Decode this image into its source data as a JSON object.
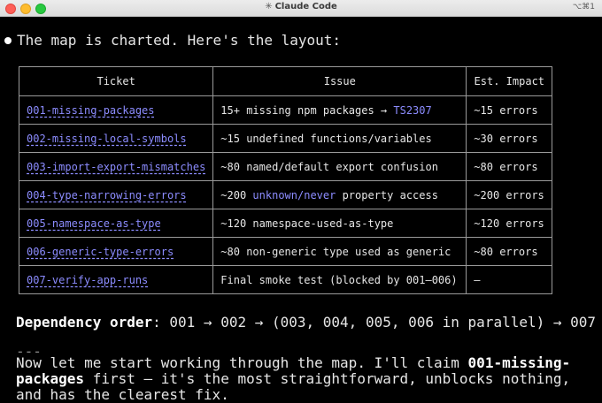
{
  "window": {
    "title": "Claude Code",
    "title_icon": "✳",
    "shortcut": "⌥⌘1"
  },
  "message": {
    "intro": "The map is charted. Here's the layout:"
  },
  "table": {
    "headers": [
      "Ticket",
      "Issue",
      "Est. Impact"
    ],
    "rows": [
      {
        "ticket": "001-missing-packages",
        "issue_pre": "15+ missing npm packages → ",
        "issue_hl": "TS2307",
        "issue_post": "",
        "impact": "~15 errors"
      },
      {
        "ticket": "002-missing-local-symbols",
        "issue_pre": "~15 undefined functions/variables",
        "issue_hl": "",
        "issue_post": "",
        "impact": "~30 errors"
      },
      {
        "ticket": "003-import-export-mismatches",
        "issue_pre": "~80 named/default export confusion",
        "issue_hl": "",
        "issue_post": "",
        "impact": "~80 errors"
      },
      {
        "ticket": "004-type-narrowing-errors",
        "issue_pre": "~200 ",
        "issue_hl": "unknown/never",
        "issue_post": " property access",
        "impact": "~200 errors"
      },
      {
        "ticket": "005-namespace-as-type",
        "issue_pre": "~120 namespace-used-as-type",
        "issue_hl": "",
        "issue_post": "",
        "impact": "~120 errors"
      },
      {
        "ticket": "006-generic-type-errors",
        "issue_pre": "~80 non-generic type used as generic",
        "issue_hl": "",
        "issue_post": "",
        "impact": "~80 errors"
      },
      {
        "ticket": "007-verify-app-runs",
        "issue_pre": "Final smoke test (blocked by 001–006)",
        "issue_hl": "",
        "issue_post": "",
        "impact": "—"
      }
    ]
  },
  "dependency": {
    "label": "Dependency order",
    "text": ": 001 → 002 → (003, 004, 005, 006 in parallel) → 007"
  },
  "separator": "---",
  "paragraph": {
    "pre": "Now let me start working through the map. I'll claim ",
    "bold": "001-missing-packages",
    "post": " first — it's the most straightforward, unblocks nothing, and has the clearest fix."
  },
  "colors": {
    "link": "#8c8cff",
    "background": "#000000",
    "text": "#e6e6e6"
  }
}
